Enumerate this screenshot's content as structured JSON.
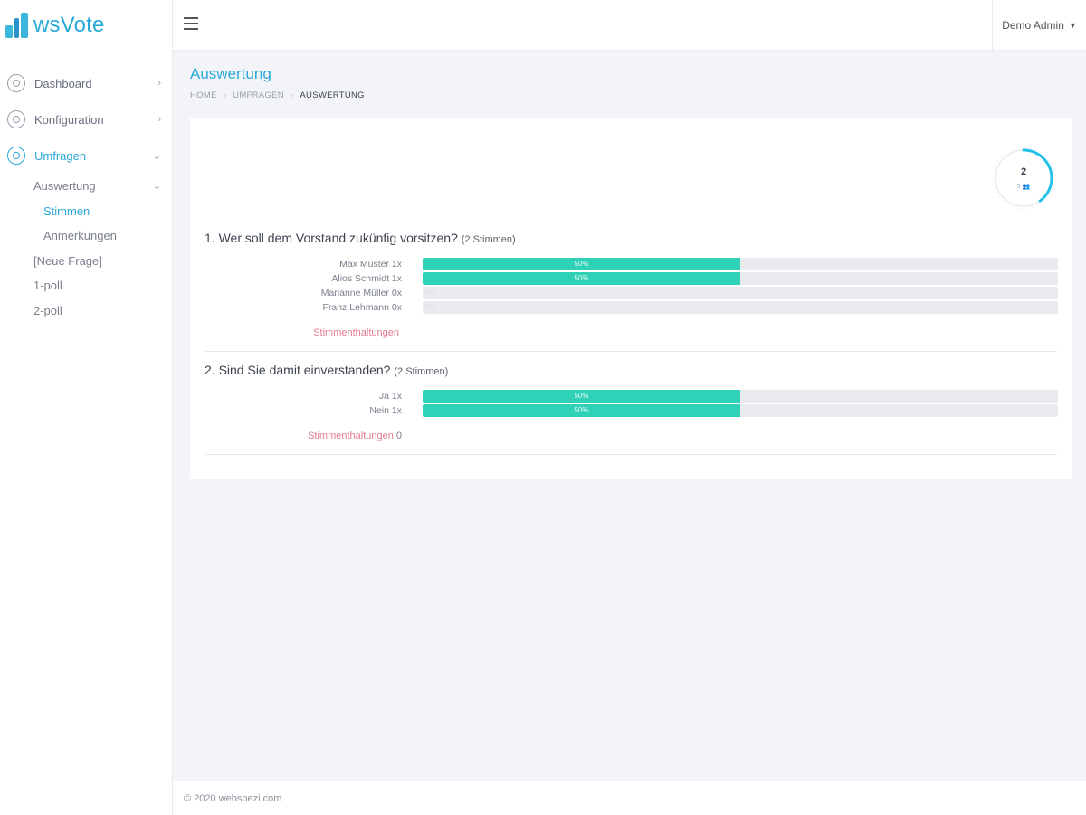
{
  "app": {
    "name": "wsVote"
  },
  "topbar": {
    "user_name": "Demo Admin"
  },
  "sidebar": {
    "items": [
      {
        "label": "Dashboard",
        "chevron": "›"
      },
      {
        "label": "Konfiguration",
        "chevron": "›"
      },
      {
        "label": "Umfragen",
        "chevron": "⌄"
      }
    ],
    "sub": {
      "auswertung": "Auswertung",
      "stimmen": "Stimmen",
      "anmerkungen": "Anmerkungen",
      "neue_frage": "[Neue Frage]",
      "poll1": "1-poll",
      "poll2": "2-poll"
    }
  },
  "page": {
    "title": "Auswertung",
    "breadcrumb": [
      "Home",
      "Umfragen",
      "Auswertung"
    ]
  },
  "summary": {
    "voted": "2",
    "total": "5 ",
    "progress": 0.4
  },
  "questions": [
    {
      "title": "1. Wer soll dem Vorstand zukünfig vorsitzen?",
      "count": "(2 Stimmen)",
      "options": [
        {
          "label": "Max Muster 1x",
          "pct": "50%",
          "value": 50
        },
        {
          "label": "Alios Schmidt 1x",
          "pct": "50%",
          "value": 50
        },
        {
          "label": "Marianne Müller 0x",
          "pct": "0%",
          "value": 0
        },
        {
          "label": "Franz Lehmann 0x",
          "pct": "0%",
          "value": 0
        }
      ],
      "abstention_label": "Stimmenthaltungen",
      "abstention_count": ""
    },
    {
      "title": "2. Sind Sie damit einverstanden?",
      "count": "(2 Stimmen)",
      "options": [
        {
          "label": "Ja 1x",
          "pct": "50%",
          "value": 50
        },
        {
          "label": "Nein 1x",
          "pct": "50%",
          "value": 50
        }
      ],
      "abstention_label": "Stimmenthaltungen",
      "abstention_count": "0"
    }
  ],
  "footer": {
    "text": "© 2020 webspezi.com"
  },
  "colors": {
    "accent": "#2aa9d8",
    "bar": "#2fd2b6",
    "abstention": "#e27a8f"
  }
}
